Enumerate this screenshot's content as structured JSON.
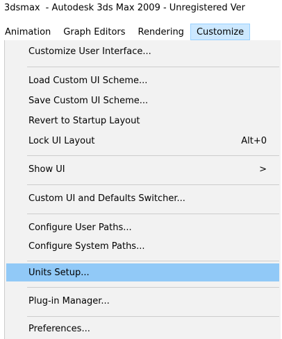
{
  "titlebar": {
    "app": "3dsmax",
    "title": "- Autodesk 3ds Max  2009  - Unregistered Ver"
  },
  "menubar": {
    "items": [
      {
        "label": "Animation"
      },
      {
        "label": "Graph Editors"
      },
      {
        "label": "Rendering"
      },
      {
        "label": "Customize"
      }
    ]
  },
  "menu": {
    "items": [
      {
        "label": "Customize User Interface..."
      },
      {
        "label": "Load Custom UI Scheme..."
      },
      {
        "label": "Save Custom UI Scheme..."
      },
      {
        "label": "Revert to Startup Layout"
      },
      {
        "label": "Lock UI Layout",
        "shortcut": "Alt+0"
      },
      {
        "label": "Show UI",
        "submenu_arrow": ">"
      },
      {
        "label": "Custom UI and Defaults Switcher..."
      },
      {
        "label": "Configure User Paths..."
      },
      {
        "label": "Configure System Paths..."
      },
      {
        "label": "Units Setup..."
      },
      {
        "label": "Plug-in Manager..."
      },
      {
        "label": "Preferences..."
      }
    ]
  },
  "colors": {
    "highlight": "#91c9f7",
    "menubar_active": "#cce8ff",
    "menu_bg": "#f2f2f2"
  }
}
